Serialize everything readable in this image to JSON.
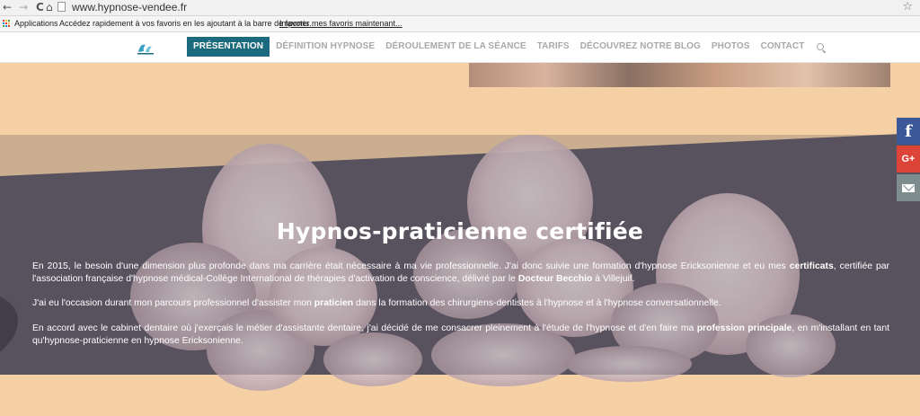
{
  "browser": {
    "url": "www.hypnose-vendee.fr",
    "back_glyph": "←",
    "forward_glyph": "→",
    "reload_glyph": "C",
    "home_glyph": "⌂",
    "star_glyph": "☆",
    "apps_label": "Applications",
    "bookmarks_prompt": "Accédez rapidement à vos favoris en les ajoutant à la barre de favoris.",
    "import_link": "Importer mes favoris maintenant..."
  },
  "nav": {
    "items": [
      {
        "label": "PRÉSENTATION"
      },
      {
        "label": "DÉFINITION HYPNOSE"
      },
      {
        "label": "DÉROULEMENT DE LA SÉANCE"
      },
      {
        "label": "TARIFS"
      },
      {
        "label": "DÉCOUVREZ NOTRE BLOG"
      },
      {
        "label": "PHOTOS"
      },
      {
        "label": "CONTACT"
      }
    ],
    "search_icon": "search-icon"
  },
  "hero": {
    "title": "Hypnos-praticienne certifiée",
    "p1": {
      "a": "En 2015, le besoin d'une dimension plus profonde dans ma carrière était nécessaire à ma vie professionnelle. J'ai donc suivie une formation d'hypnose Ericksonienne et eu mes ",
      "b": "certificats",
      "c": ", certifiée par l'association française d'hypnose médical-Collège International de thérapies d'activation de conscience, délivré par le ",
      "d": "Docteur Becchio",
      "e": " à Villejuif."
    },
    "p2": {
      "a": "J'ai eu l'occasion durant mon parcours professionnel d'assister mon ",
      "b": "praticien",
      "c": " dans la formation des chirurgiens-dentistes à l'hypnose et à l'hypnose conversationnelle."
    },
    "p3": {
      "a": "En accord avec le cabinet dentaire où j'exerçais le métier d'assistante dentaire, j'ai décidé de me consacrer pleinement à l'étude de l'hypnose et d'en faire ma ",
      "b": "profession principale",
      "c": ", en m'installant en tant qu'hypnose-praticienne en hypnose Ericksonienne."
    }
  },
  "social": {
    "facebook": "f",
    "googleplus": "G+",
    "email_icon": "envelope-icon"
  },
  "colors": {
    "accent": "#1c6a7d",
    "background": "#f4d0a4",
    "hero_bg": "#5f5a66",
    "facebook": "#3b5998",
    "googleplus": "#db4437",
    "mail": "#7f8c8d"
  }
}
